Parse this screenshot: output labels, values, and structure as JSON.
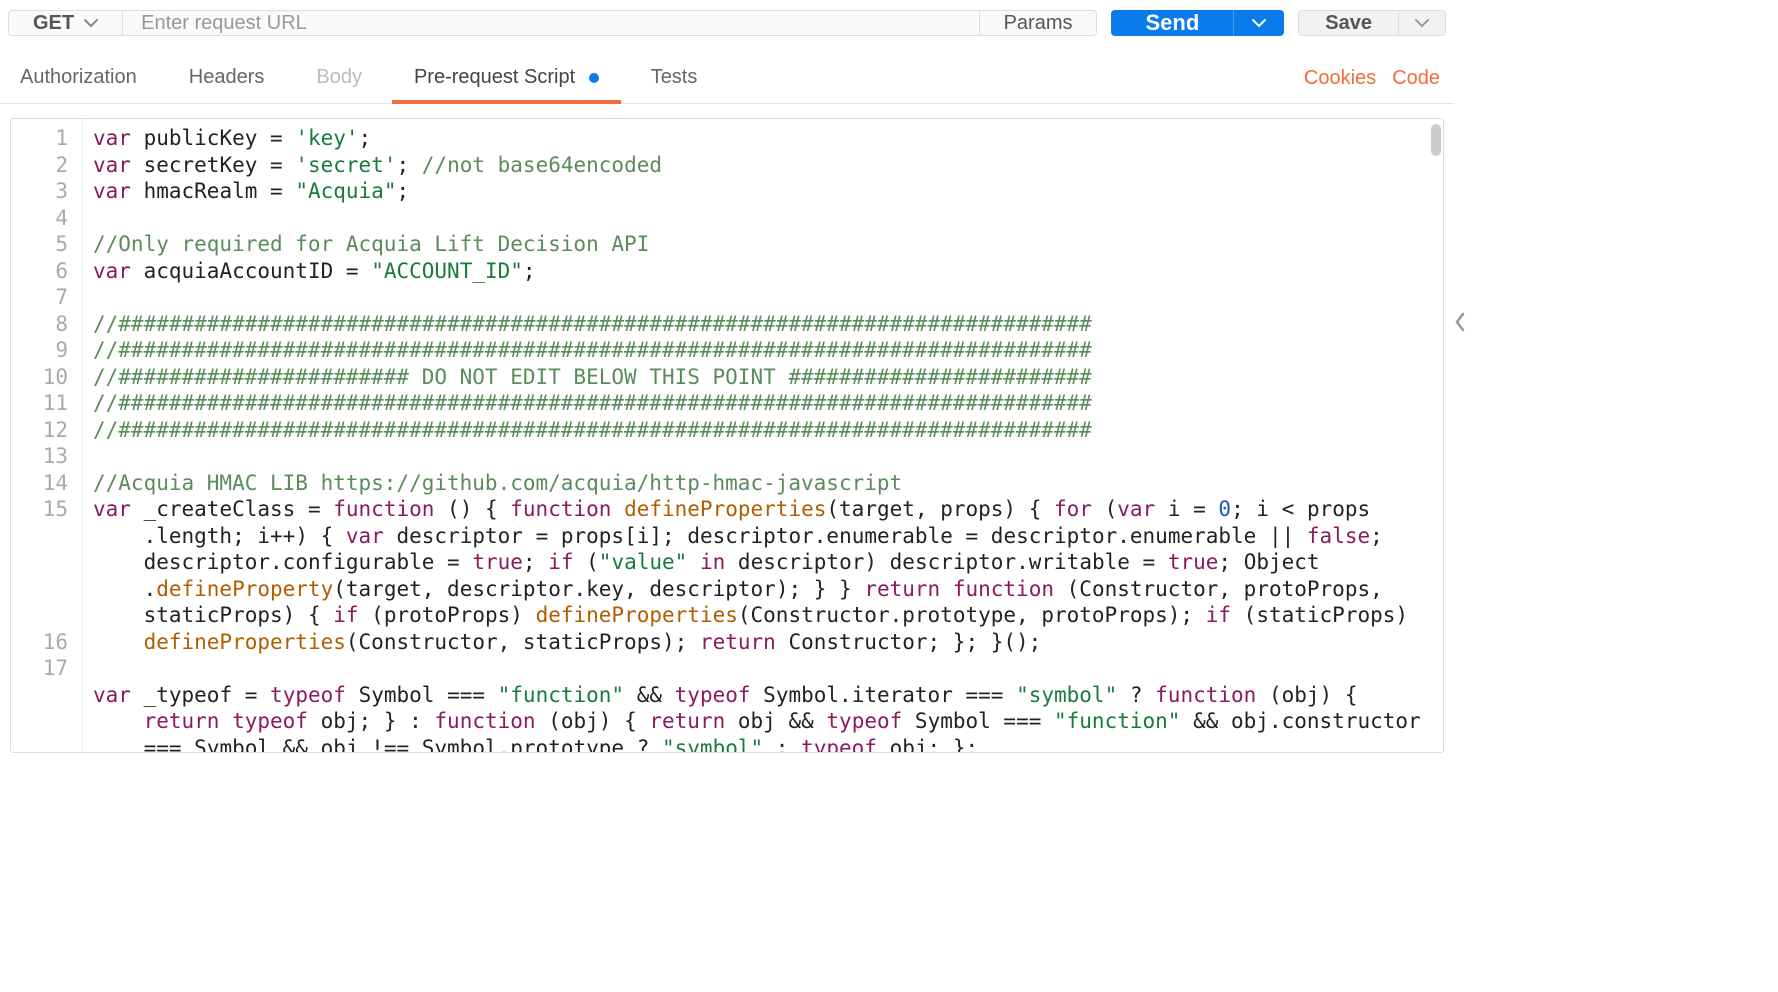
{
  "request": {
    "method": "GET",
    "url_placeholder": "Enter request URL",
    "params_label": "Params",
    "send_label": "Send",
    "save_label": "Save"
  },
  "tabs": {
    "authorization": "Authorization",
    "headers": "Headers",
    "body": "Body",
    "prerequest": "Pre-request Script",
    "tests": "Tests",
    "active": "prerequest",
    "prerequest_modified": true
  },
  "links": {
    "cookies": "Cookies",
    "code": "Code"
  },
  "editor": {
    "line_numbers": [
      1,
      2,
      3,
      4,
      5,
      6,
      7,
      8,
      9,
      10,
      11,
      12,
      13,
      14,
      15,
      16,
      17
    ],
    "code_lines": [
      "var publicKey = 'key';",
      "var secretKey = 'secret'; //not base64encoded",
      "var hmacRealm = \"Acquia\";",
      "",
      "//Only required for Acquia Lift Decision API",
      "var acquiaAccountID = \"ACCOUNT_ID\";",
      "",
      "//#############################################################################",
      "//#############################################################################",
      "//####################### DO NOT EDIT BELOW THIS POINT ########################",
      "//#############################################################################",
      "//#############################################################################",
      "",
      "//Acquia HMAC LIB https://github.com/acquia/http-hmac-javascript",
      "var _createClass = function () { function defineProperties(target, props) { for (var i = 0; i < props.length; i++) { var descriptor = props[i]; descriptor.enumerable = descriptor.enumerable || false; descriptor.configurable = true; if (\"value\" in descriptor) descriptor.writable = true; Object.defineProperty(target, descriptor.key, descriptor); } } return function (Constructor, protoProps, staticProps) { if (protoProps) defineProperties(Constructor.prototype, protoProps); if (staticProps) defineProperties(Constructor, staticProps); return Constructor; }; }();",
      "",
      "var _typeof = typeof Symbol === \"function\" && typeof Symbol.iterator === \"symbol\" ? function (obj) { return typeof obj; } : function (obj) { return obj && typeof Symbol === \"function\" && obj.constructor === Symbol && obj !== Symbol.prototype ? \"symbol\" : typeof obj; };"
    ]
  }
}
